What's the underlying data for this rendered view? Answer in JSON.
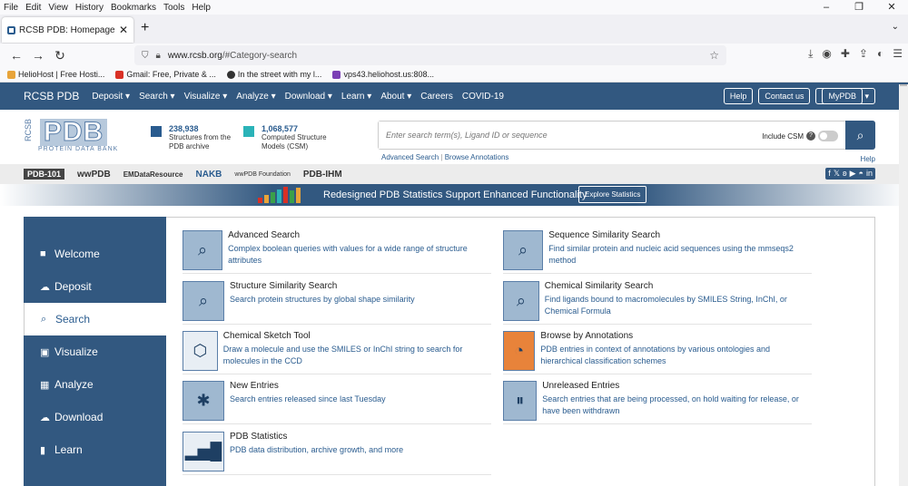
{
  "browser": {
    "menu": [
      "File",
      "Edit",
      "View",
      "History",
      "Bookmarks",
      "Tools",
      "Help"
    ],
    "tab_title": "RCSB PDB: Homepage",
    "url_host": "www.rcsb.org",
    "url_path": "/#Category-search",
    "bookmarks": [
      "HelioHost | Free Hosti...",
      "Gmail: Free, Private & ...",
      "In the street with my l...",
      "vps43.heliohost.us:808..."
    ]
  },
  "nav": {
    "brand": "RCSB PDB",
    "items": [
      "Deposit",
      "Search",
      "Visualize",
      "Analyze",
      "Download",
      "Learn",
      "About",
      "Careers",
      "COVID-19"
    ],
    "help": "Help",
    "contact": "Contact us",
    "mypdb": "MyPDB"
  },
  "logo": {
    "rcsb": "RCSB",
    "pdb": "PDB",
    "sub": "PROTEIN DATA BANK"
  },
  "stats": [
    {
      "num": "238,938",
      "l1": "Structures from the",
      "l2": "PDB archive"
    },
    {
      "num": "1,068,577",
      "l1": "Computed Structure",
      "l2": "Models (CSM)"
    }
  ],
  "search": {
    "placeholder": "Enter search term(s), Ligand ID or sequence",
    "csm": "Include CSM",
    "adv": "Advanced Search",
    "ann": "Browse Annotations",
    "help": "Help"
  },
  "partners": [
    "PDB-101",
    "wwPDB",
    "EMDataResource",
    "NAKB",
    "wwPDB Foundation",
    "PDB-IHM"
  ],
  "banner": {
    "text": "Redesigned PDB Statistics Support Enhanced Functionality",
    "button": "Explore Statistics"
  },
  "sidebar": [
    "Welcome",
    "Deposit",
    "Search",
    "Visualize",
    "Analyze",
    "Download",
    "Learn"
  ],
  "cards": [
    {
      "title": "Advanced Search",
      "desc": "Complex boolean queries with values for a wide range of structure attributes"
    },
    {
      "title": "Sequence Similarity Search",
      "desc": "Find similar protein and nucleic acid sequences using the mmseqs2 method"
    },
    {
      "title": "Structure Similarity Search",
      "desc": "Search protein structures by global shape similarity"
    },
    {
      "title": "Chemical Similarity Search",
      "desc": "Find ligands bound to macromolecules by SMILES String, InChI, or Chemical Formula"
    },
    {
      "title": "Chemical Sketch Tool",
      "desc": "Draw a molecule and use the SMILES or InChI string to search for molecules in the CCD"
    },
    {
      "title": "Browse by Annotations",
      "desc": "PDB entries in context of annotations by various ontologies and hierarchical classification schemes"
    },
    {
      "title": "New Entries",
      "desc": "Search entries released since last Tuesday"
    },
    {
      "title": "Unreleased Entries",
      "desc": "Search entries that are being processed, on hold waiting for release, or have been withdrawn"
    },
    {
      "title": "PDB Statistics",
      "desc": "PDB data distribution, archive growth, and more"
    }
  ]
}
